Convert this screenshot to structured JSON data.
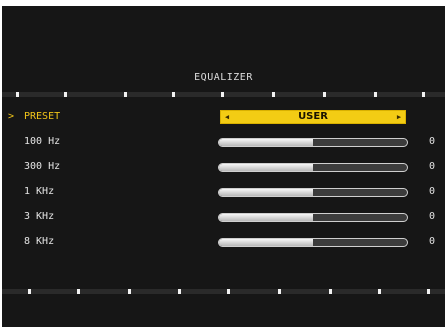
{
  "title": "EQUALIZER",
  "colors": {
    "background": "#161616",
    "accent": "#F3CC14",
    "text": "#E4E4E4"
  },
  "preset": {
    "label": "PRESET",
    "value": "USER",
    "cursor": ">",
    "left_arrow": "◀",
    "right_arrow": "▶"
  },
  "bands": [
    {
      "label": "100 Hz",
      "value": "0",
      "level": 0.5
    },
    {
      "label": "300 Hz",
      "value": "0",
      "level": 0.5
    },
    {
      "label": "1 KHz",
      "value": "0",
      "level": 0.5
    },
    {
      "label": "3 KHz",
      "value": "0",
      "level": 0.5
    },
    {
      "label": "8 KHz",
      "value": "0",
      "level": 0.5
    }
  ]
}
